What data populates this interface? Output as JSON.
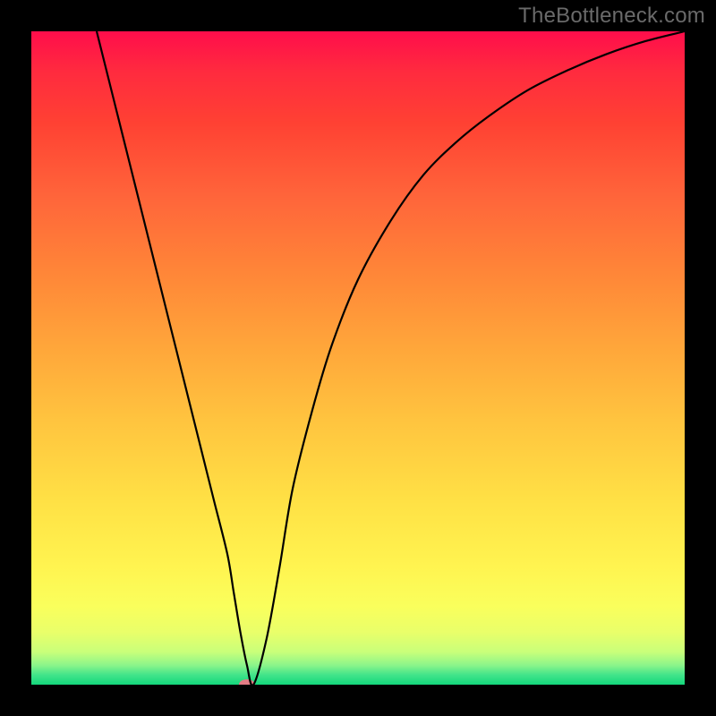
{
  "watermark": "TheBottleneck.com",
  "chart_data": {
    "type": "line",
    "title": "",
    "xlabel": "",
    "ylabel": "",
    "xlim": [
      0,
      100
    ],
    "ylim": [
      0,
      100
    ],
    "grid": false,
    "curve": {
      "x": [
        10,
        12,
        14,
        16,
        18,
        20,
        22,
        24,
        26,
        28,
        30,
        31,
        32,
        33,
        34,
        36,
        38,
        40,
        43,
        46,
        50,
        55,
        60,
        65,
        70,
        76,
        82,
        88,
        94,
        100
      ],
      "y": [
        100,
        92,
        84,
        76,
        68,
        60,
        52,
        44,
        36,
        28,
        20,
        14,
        8,
        3,
        0,
        7,
        18,
        30,
        42,
        52,
        62,
        71,
        78,
        83,
        87,
        91,
        94,
        96.5,
        98.5,
        100
      ]
    },
    "marker": {
      "x": 33,
      "y": 0,
      "color": "#e27b84",
      "rx": 9,
      "ry": 6
    },
    "gradient_stops": [
      {
        "pct": 0,
        "color": "#ff0d4b"
      },
      {
        "pct": 6,
        "color": "#ff2a3f"
      },
      {
        "pct": 14,
        "color": "#ff4133"
      },
      {
        "pct": 25,
        "color": "#ff643a"
      },
      {
        "pct": 37,
        "color": "#ff8638"
      },
      {
        "pct": 48,
        "color": "#ffa53a"
      },
      {
        "pct": 60,
        "color": "#ffc53f"
      },
      {
        "pct": 72,
        "color": "#ffe145"
      },
      {
        "pct": 82,
        "color": "#fff450"
      },
      {
        "pct": 88,
        "color": "#faff5c"
      },
      {
        "pct": 92,
        "color": "#e9ff6a"
      },
      {
        "pct": 95,
        "color": "#c9ff7a"
      },
      {
        "pct": 97,
        "color": "#8cf58a"
      },
      {
        "pct": 98.5,
        "color": "#42e48a"
      },
      {
        "pct": 100,
        "color": "#14d77c"
      }
    ]
  }
}
